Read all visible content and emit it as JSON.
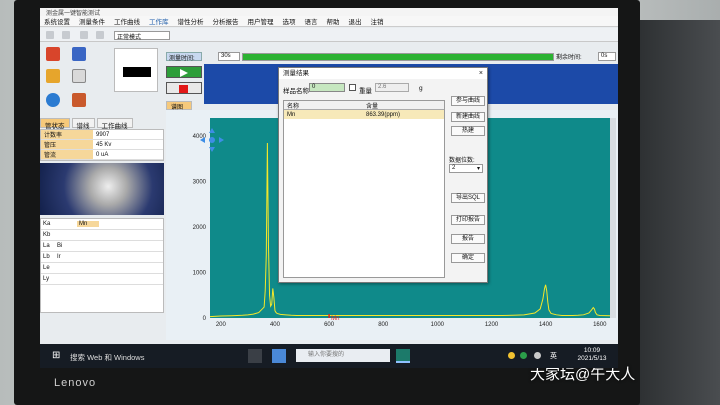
{
  "app": {
    "window_title": "测金属一键智能测试"
  },
  "menu": [
    "系统设置",
    "测量条件",
    "工作曲线",
    "工作库",
    "谱性分析",
    "分析报告",
    "用户管理",
    "选项",
    "语言",
    "帮助",
    "退出",
    "注销"
  ],
  "menu_active_index": 3,
  "toolbar": {
    "mode_value": "正常模式"
  },
  "measure": {
    "time_label": "测量时间:",
    "time_value": "30s",
    "progress_pct": 100,
    "remain_label": "剩余时间:",
    "remain_value": "0s"
  },
  "left_tabs": [
    "管状态",
    "谱线",
    "工作曲线"
  ],
  "left_tab_selected": 0,
  "properties": [
    {
      "name": "计数率",
      "value": "9907"
    },
    {
      "name": "管压",
      "value": "45 Kv"
    },
    {
      "name": "管流",
      "value": "0 uA"
    }
  ],
  "element_rows": [
    {
      "line": "Ka",
      "e1": "",
      "e2": "Mn"
    },
    {
      "line": "Kb",
      "e1": "",
      "e2": ""
    },
    {
      "line": "La",
      "e1": "Bi",
      "e2": ""
    },
    {
      "line": "Lb",
      "e1": "Ir",
      "e2": ""
    },
    {
      "line": "Le",
      "e1": "",
      "e2": ""
    },
    {
      "line": "Ly",
      "e1": "",
      "e2": ""
    }
  ],
  "spectrum_tab": "谱图",
  "dialog": {
    "title": "测量结果",
    "close": "×",
    "sample_label": "样品名称",
    "sample_value": "0",
    "weight_label": "重量",
    "weight_value": "2.6",
    "weight_unit": "g",
    "columns": [
      "名称",
      "含量"
    ],
    "rows": [
      {
        "name": "Mn",
        "content": "863.39(ppm)"
      }
    ],
    "buttons": {
      "ref_curve": "参与曲线",
      "new_curve": "新建曲线",
      "save_tag": "热建",
      "export_sql": "导出SQL",
      "print_report": "打印报告",
      "report": "报告",
      "ok": "确定"
    },
    "digits_label": "数据位数:",
    "digits_value": "2",
    "digits_arrow": "▾"
  },
  "chart_data": {
    "type": "line",
    "title": "",
    "xlabel": "",
    "ylabel": "",
    "xlim": [
      160,
      1660
    ],
    "ylim": [
      0,
      4400
    ],
    "x_ticks": [
      200,
      400,
      600,
      800,
      1000,
      1200,
      1400,
      1600
    ],
    "y_ticks": [
      0,
      1000,
      2000,
      3000,
      4000
    ],
    "marker_label": "Mn",
    "marker_x": 600,
    "colors": {
      "background": "#0f8a8a",
      "line": "#f5e829",
      "frame": "#e9f0f5"
    },
    "series": [
      {
        "x": [
          160,
          200,
          240,
          280,
          300,
          320,
          340,
          360,
          364,
          368,
          372,
          376,
          380,
          384,
          388,
          392,
          396,
          400,
          404,
          408,
          420,
          440,
          460,
          480,
          500,
          520,
          540,
          560,
          580,
          600,
          620,
          640,
          660,
          680,
          700,
          720,
          760,
          800,
          840,
          880,
          920,
          960,
          1000,
          1040,
          1080,
          1120,
          1160,
          1200,
          1240,
          1280,
          1320,
          1360,
          1380,
          1390,
          1396,
          1400,
          1404,
          1408,
          1412,
          1420,
          1440,
          1460,
          1480,
          1500,
          1520,
          1540,
          1560,
          1570,
          1576,
          1580,
          1584,
          1590,
          1600,
          1640,
          1660
        ],
        "y": [
          30,
          45,
          50,
          60,
          70,
          85,
          120,
          240,
          600,
          1400,
          3850,
          1600,
          500,
          260,
          300,
          650,
          450,
          160,
          120,
          100,
          80,
          70,
          60,
          55,
          55,
          55,
          55,
          55,
          55,
          55,
          55,
          55,
          55,
          55,
          55,
          55,
          55,
          55,
          55,
          55,
          55,
          55,
          55,
          55,
          55,
          55,
          55,
          55,
          55,
          60,
          70,
          110,
          200,
          420,
          650,
          730,
          600,
          350,
          180,
          100,
          70,
          55,
          55,
          55,
          60,
          70,
          110,
          180,
          230,
          200,
          120,
          70,
          55,
          50,
          45
        ]
      }
    ]
  },
  "taskbar": {
    "start_icon": "windows-icon",
    "search_text": "搜索 Web 和 Windows",
    "input_placeholder": "输入你要搜的",
    "ime": "英",
    "time": "10:09",
    "date": "2021/5/13"
  },
  "monitor": {
    "brand": "Lenovo"
  },
  "watermark": "大家坛@午大人"
}
